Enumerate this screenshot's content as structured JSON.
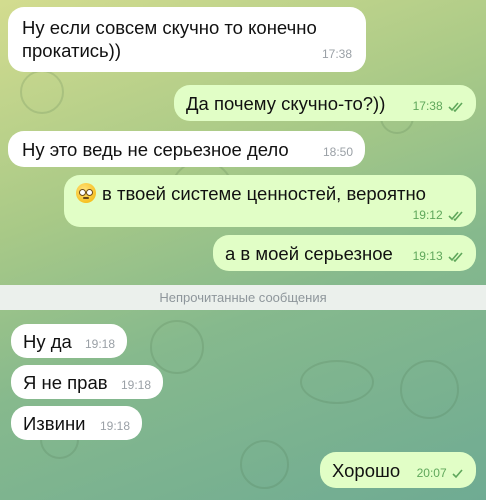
{
  "messages": [
    {
      "id": "m1",
      "direction": "in",
      "text_line1": "Ну если совсем скучно то конечно",
      "text_line2": "прокатись))",
      "time": "17:38"
    },
    {
      "id": "m2",
      "direction": "out",
      "text": "Да почему скучно-то?))",
      "time": "17:38",
      "status": "read"
    },
    {
      "id": "m3",
      "direction": "in",
      "text": "Ну это ведь не серьезное дело",
      "time": "18:50"
    },
    {
      "id": "m4",
      "direction": "out",
      "emoji": "rolling-eyes-emoji",
      "text": "в твоей системе ценностей, вероятно",
      "time": "19:12",
      "status": "read"
    },
    {
      "id": "m5",
      "direction": "out",
      "text": "а в моей серьезное",
      "time": "19:13",
      "status": "read"
    },
    {
      "id": "m6",
      "direction": "in",
      "text": "Ну да",
      "time": "19:18"
    },
    {
      "id": "m7",
      "direction": "in",
      "text": "Я не прав",
      "time": "19:18"
    },
    {
      "id": "m8",
      "direction": "in",
      "text": "Извини",
      "time": "19:18"
    },
    {
      "id": "m9",
      "direction": "out",
      "text": "Хорошо",
      "time": "20:07",
      "status": "delivered"
    }
  ],
  "unread_divider": {
    "label": "Непрочитанные сообщения"
  },
  "colors": {
    "incoming_bubble": "#ffffff",
    "outgoing_bubble": "#e1fec6",
    "outgoing_time": "#5fa75b",
    "incoming_time": "#9aa0a6",
    "unread_bar": "#ebf0ec"
  }
}
